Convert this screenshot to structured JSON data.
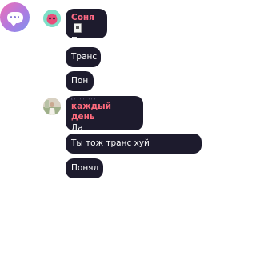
{
  "messages": [
    {
      "author": "Соня",
      "author_color": "#ff6a85",
      "lines": [
        "Пон",
        "Транс",
        "Пон"
      ]
    },
    {
      "author": "каждый день",
      "author_decoration": "ꜜ ᵎ ᵎ ᵎ ᵎ ᵎ ᵎ ᵎ ᵎ",
      "author_color": "#ff6b7d",
      "lines": [
        "Да",
        "Ты тож транс хуй покажешь?",
        "Понял"
      ]
    }
  ],
  "colors": {
    "bubble_bg": "#1d1b2d",
    "bubble_text": "#ffffff",
    "fab_gradient": [
      "#f06fb5",
      "#b07ae0",
      "#7c93ee"
    ]
  },
  "icons": {
    "fab": "chat-bubble-dots-icon",
    "badge": "id-card-icon"
  }
}
